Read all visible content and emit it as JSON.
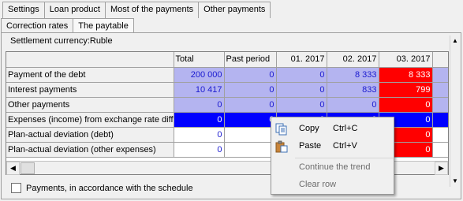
{
  "tabs_top": [
    "Settings",
    "Loan product",
    "Most of the payments",
    "Other payments"
  ],
  "tabs_second": [
    "Correction rates",
    "The paytable"
  ],
  "currency_label": "Settlement currency:Ruble",
  "grid": {
    "columns": [
      "Total",
      "Past period",
      "01. 2017",
      "02. 2017",
      "03. 2017"
    ],
    "rows": [
      {
        "label": "Payment of the debt",
        "cells": [
          "200 000",
          "0",
          "0",
          "8 333",
          "8 333"
        ]
      },
      {
        "label": "Interest payments",
        "cells": [
          "10 417",
          "0",
          "0",
          "833",
          "799"
        ]
      },
      {
        "label": "Other payments",
        "cells": [
          "0",
          "0",
          "0",
          "0",
          "0"
        ]
      },
      {
        "label": "Expenses (income) from exchange rate diffe",
        "cells": [
          "0",
          "0",
          "0",
          "0",
          "0"
        ]
      },
      {
        "label": "Plan-actual deviation (debt)",
        "cells": [
          "0",
          "",
          "",
          "",
          "0"
        ]
      },
      {
        "label": "Plan-actual deviation (other expenses)",
        "cells": [
          "0",
          "",
          "",
          "",
          "0"
        ]
      }
    ]
  },
  "checkbox_label": "Payments, in accordance with the schedule",
  "context_menu": {
    "copy_label": "Copy",
    "copy_shortcut": "Ctrl+C",
    "paste_label": "Paste",
    "paste_shortcut": "Ctrl+V",
    "continue_label": "Continue the trend",
    "clear_label": "Clear row"
  },
  "colors": {
    "lavender": "#b4b4f0",
    "red": "#ff0000",
    "selection": "#0000ff",
    "value_text": "#1a1ad0"
  },
  "icons": [
    "copy-icon",
    "paste-icon",
    "scroll-left-icon",
    "scroll-right-icon",
    "scroll-up-icon",
    "scroll-down-icon"
  ]
}
